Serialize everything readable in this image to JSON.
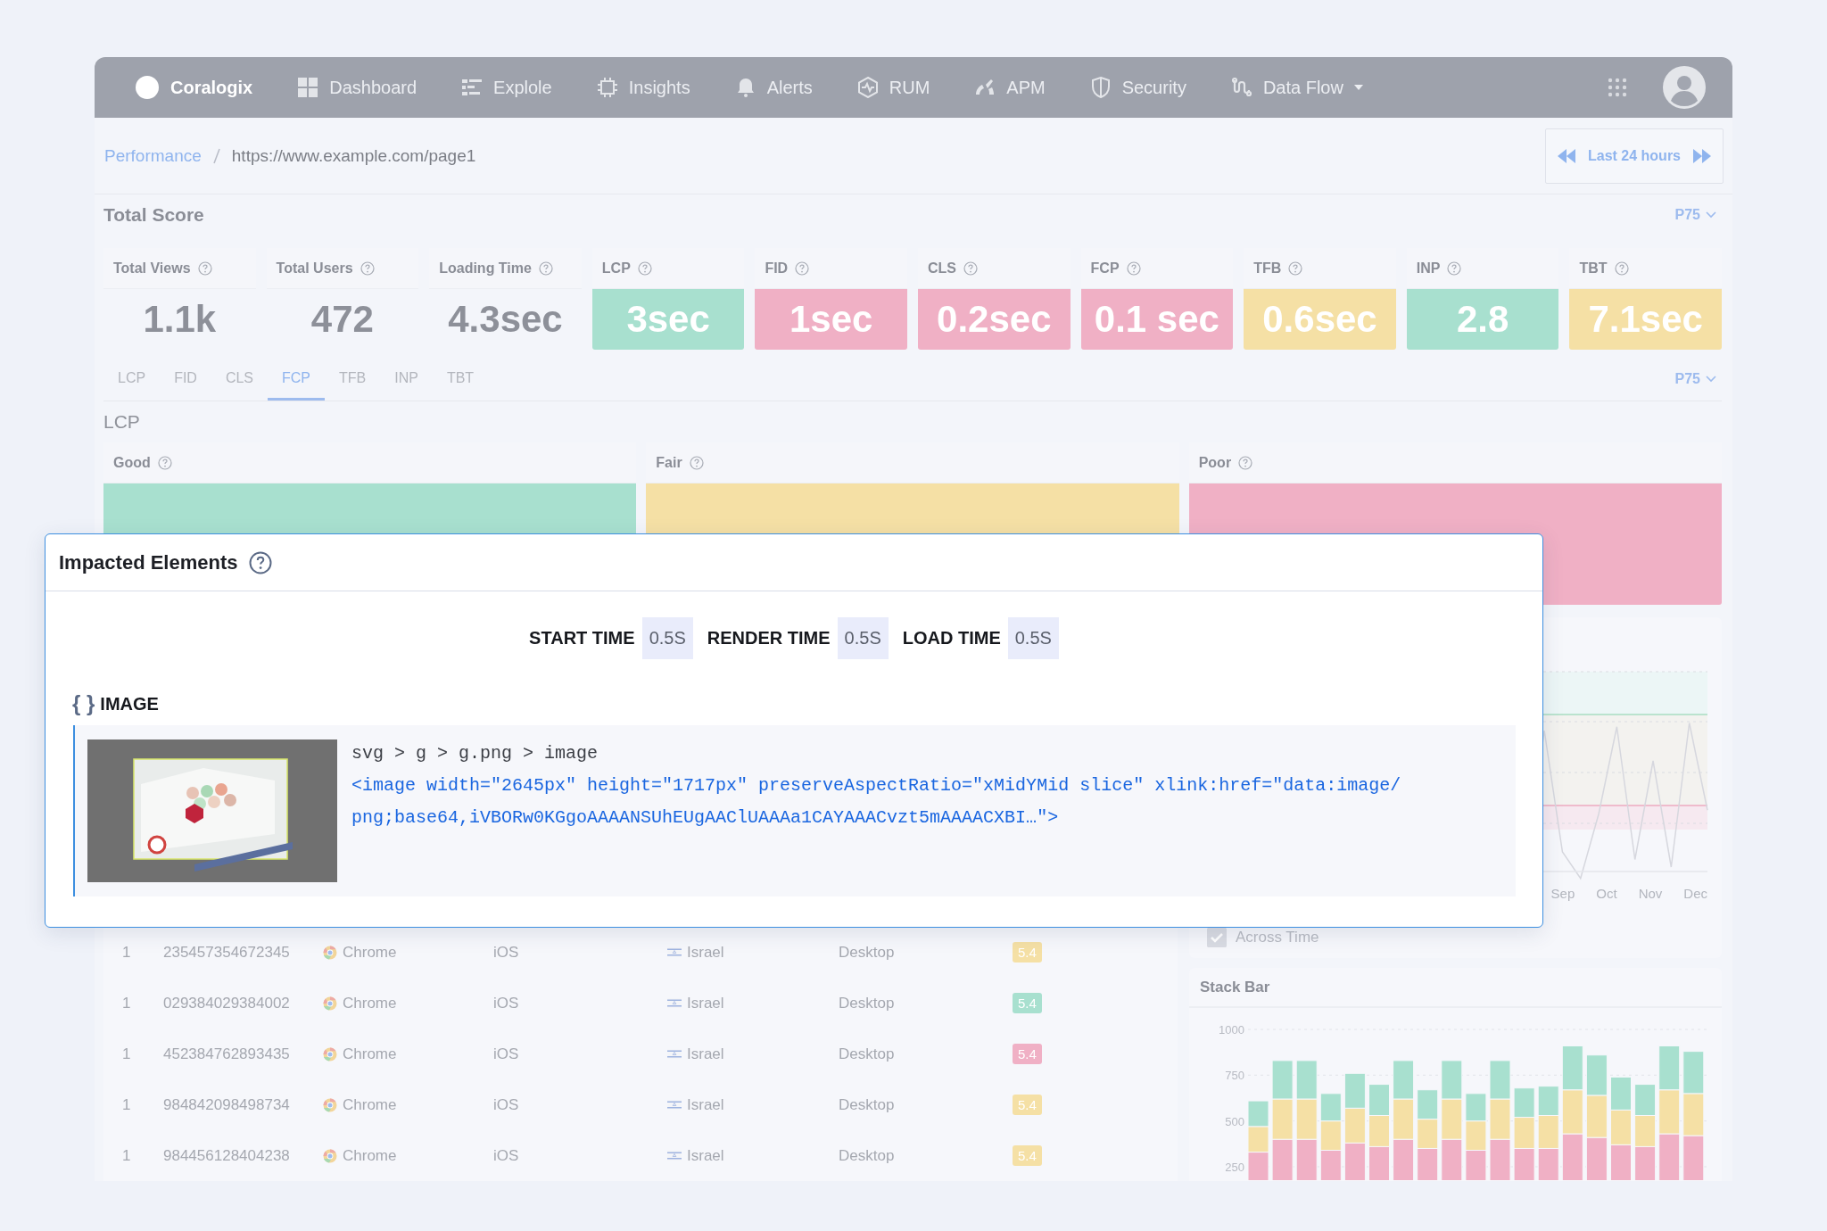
{
  "nav": {
    "logo": "Coralogix",
    "items": [
      {
        "label": "Dashboard",
        "kind": "grid",
        "dropdown": false
      },
      {
        "label": "Explole",
        "kind": "bars",
        "dropdown": false
      },
      {
        "label": "Insights",
        "kind": "chip",
        "dropdown": false
      },
      {
        "label": "Alerts",
        "kind": "bell",
        "dropdown": false
      },
      {
        "label": "RUM",
        "kind": "hex",
        "dropdown": false
      },
      {
        "label": "APM",
        "kind": "gauge",
        "dropdown": false
      },
      {
        "label": "Security",
        "kind": "shield",
        "dropdown": false
      },
      {
        "label": "Data Flow",
        "kind": "flow",
        "dropdown": true
      }
    ]
  },
  "breadcrumb": [
    {
      "label": "Performance",
      "link": true
    },
    {
      "label": "https://www.example.com/page1",
      "link": false
    }
  ],
  "time_range": {
    "label": "Last 24 hours"
  },
  "total_score": {
    "title": "Total Score",
    "percentile": "P75",
    "cards": [
      {
        "label": "Total Views",
        "value": "1.1k"
      },
      {
        "label": "Total Users",
        "value": "472"
      },
      {
        "label": "Loading Time",
        "value": "4.3sec"
      },
      {
        "label": "LCP",
        "value": "3sec",
        "color": "#a8e0cf"
      },
      {
        "label": "FID",
        "value": "1sec",
        "color": "#f0b0c5"
      },
      {
        "label": "CLS",
        "value": "0.2sec",
        "color": "#f0b0c5"
      },
      {
        "label": "FCP",
        "value": "0.1 sec",
        "color": "#f0b0c5"
      },
      {
        "label": "TFB",
        "value": "0.6sec",
        "color": "#f5e0a5"
      },
      {
        "label": "INP",
        "value": "2.8",
        "color": "#a8e0cf"
      },
      {
        "label": "TBT",
        "value": "7.1sec",
        "color": "#f5e0a5"
      }
    ]
  },
  "metric_tabs": {
    "percentile": "P75",
    "tabs": [
      {
        "label": "LCP",
        "selected": false
      },
      {
        "label": "FID",
        "selected": false
      },
      {
        "label": "CLS",
        "selected": false
      },
      {
        "label": "FCP",
        "selected": true
      },
      {
        "label": "TFB",
        "selected": false
      },
      {
        "label": "INP",
        "selected": false
      },
      {
        "label": "TBT",
        "selected": false
      }
    ]
  },
  "distribution": {
    "title": "LCP",
    "buckets": [
      {
        "label": "Good",
        "color": "#a8e0cf"
      },
      {
        "label": "Fair",
        "color": "#f5e0a5"
      },
      {
        "label": "Poor",
        "color": "#f0b0c5"
      }
    ]
  },
  "sessions_table": {
    "rows": [
      {
        "rank": "1",
        "id": "235457354672345",
        "browser": "Chrome",
        "os": "iOS",
        "country": "Israel",
        "device": "Desktop",
        "score": "5.4",
        "color": "#f5e0a5"
      },
      {
        "rank": "1",
        "id": "029384029384002",
        "browser": "Chrome",
        "os": "iOS",
        "country": "Israel",
        "device": "Desktop",
        "score": "5.4",
        "color": "#a8e0cf"
      },
      {
        "rank": "1",
        "id": "452384762893435",
        "browser": "Chrome",
        "os": "iOS",
        "country": "Israel",
        "device": "Desktop",
        "score": "5.4",
        "color": "#f0b0c5"
      },
      {
        "rank": "1",
        "id": "984842098498734",
        "browser": "Chrome",
        "os": "iOS",
        "country": "Israel",
        "device": "Desktop",
        "score": "5.4",
        "color": "#f5e0a5"
      },
      {
        "rank": "1",
        "id": "984456128404238",
        "browser": "Chrome",
        "os": "iOS",
        "country": "Israel",
        "device": "Desktop",
        "score": "5.4",
        "color": "#f5e0a5"
      }
    ]
  },
  "trend_panel": {
    "x_labels": [
      "Sep",
      "Oct",
      "Nov",
      "Dec"
    ],
    "toggle": {
      "label": "Across Time",
      "checked": true
    }
  },
  "stack_bar": {
    "title": "Stack Bar",
    "chart_data": {
      "type": "bar",
      "stacked": true,
      "grid": true,
      "ylim": [
        0,
        1000
      ],
      "yticks": [
        250,
        500,
        750,
        1000
      ],
      "series": [
        {
          "color": "#f0b0c5",
          "values": [
            330,
            400,
            400,
            340,
            380,
            360,
            400,
            350,
            400,
            340,
            400,
            350,
            350,
            430,
            410,
            370,
            360,
            430,
            420
          ]
        },
        {
          "color": "#f5e0a5",
          "values": [
            140,
            220,
            220,
            160,
            190,
            170,
            220,
            160,
            220,
            160,
            220,
            170,
            180,
            240,
            230,
            190,
            170,
            240,
            230
          ]
        },
        {
          "color": "#a8e0cf",
          "values": [
            140,
            210,
            210,
            150,
            190,
            170,
            210,
            160,
            210,
            150,
            210,
            160,
            160,
            240,
            220,
            180,
            170,
            240,
            230
          ]
        }
      ]
    }
  },
  "impacted_elements": {
    "title": "Impacted Elements",
    "timings": [
      {
        "label": "START TIME",
        "value": "0.5S"
      },
      {
        "label": "RENDER TIME",
        "value": "0.5S"
      },
      {
        "label": "LOAD TIME",
        "value": "0.5S"
      }
    ],
    "type_icon": "{ }",
    "element_type": "IMAGE",
    "selector": "svg > g > g.png > image",
    "code_lines": [
      "<image width=\"2645px\" height=\"1717px\" preserveAspectRatio=\"xMidYMid slice\" xlink:href=\"data:image/",
      "png;base64,iVBORw0KGgoAAAANSUhEUgAAClUAAAa1CAYAAACvzt5mAAAACXBI…\">"
    ],
    "preview": {
      "kind": "picture"
    }
  }
}
